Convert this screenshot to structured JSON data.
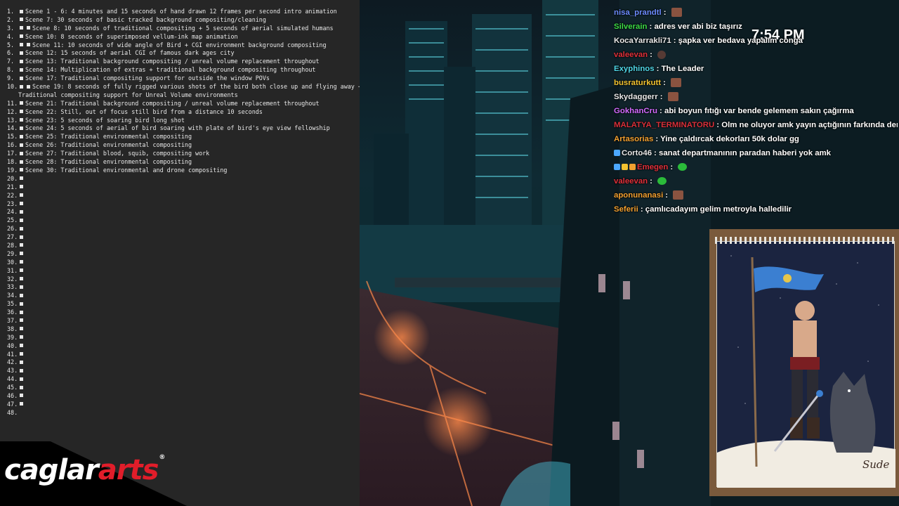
{
  "notes": {
    "items": [
      {
        "num": "1.",
        "text": "Scene 1 - 6: 4 minutes and 15 seconds of hand drawn 12 frames per second intro animation",
        "bullets": 1
      },
      {
        "num": "2.",
        "text": "Scene 7: 30 seconds of basic tracked background compositing/cleaning",
        "bullets": 1
      },
      {
        "num": "3.",
        "text": "Scene 8: 10 seconds of traditional compositing + 5 seconds of aerial simulated humans",
        "bullets": 2
      },
      {
        "num": "4.",
        "text": "Scene 10: 8 seconds of superimposed vellum-ink map animation",
        "bullets": 1
      },
      {
        "num": "5.",
        "text": "Scene 11: 10 seconds of wide angle of Bird + CGI environment background compositing",
        "bullets": 2
      },
      {
        "num": "6.",
        "text": "Scene 12: 15 seconds of aerial CGI of famous dark ages city",
        "bullets": 1
      },
      {
        "num": "7.",
        "text": "Scene 13: Traditional background compositing / unreal volume replacement throughout",
        "bullets": 1
      },
      {
        "num": "8.",
        "text": "Scene 14: Multiplication of extras + traditional background compositing throughout",
        "bullets": 1
      },
      {
        "num": "9.",
        "text": "Scene 17: Traditional compositing support for outside the window POVs",
        "bullets": 1
      },
      {
        "num": "10.",
        "text": "Scene 19: 8 seconds of fully rigged various shots of the bird both close up and flying away +",
        "bullets": 2,
        "wrap": "Traditional compositing support for Unreal Volume environments"
      },
      {
        "num": "11.",
        "text": "Scene 21: Traditional background compositing / unreal volume replacement throughout",
        "bullets": 1
      },
      {
        "num": "12.",
        "text": "Scene 22: Still, out of focus still bird from a distance 10 seconds",
        "bullets": 1
      },
      {
        "num": "13.",
        "text": "Scene 23: 5 seconds of soaring bird long shot",
        "bullets": 1
      },
      {
        "num": "14.",
        "text": "Scene 24: 5 seconds of aerial of bird soaring with plate of bird's eye view fellowship",
        "bullets": 1
      },
      {
        "num": "15.",
        "text": "Scene 25: Traditional environmental compositing",
        "bullets": 1
      },
      {
        "num": "16.",
        "text": "Scene 26: Traditional environmental compositing",
        "bullets": 1
      },
      {
        "num": "17.",
        "text": "Scene 27: Traditional blood, squib, compositing work",
        "bullets": 1
      },
      {
        "num": "18.",
        "text": "Scene 28: Traditional environmental compositing",
        "bullets": 1
      },
      {
        "num": "19.",
        "text": "Scene 30:  Traditional environmental and drone compositing",
        "bullets": 1
      },
      {
        "num": "20.",
        "text": "",
        "bullets": 1
      },
      {
        "num": "21.",
        "text": "",
        "bullets": 1
      },
      {
        "num": "22.",
        "text": "",
        "bullets": 1
      },
      {
        "num": "23.",
        "text": "",
        "bullets": 1
      },
      {
        "num": "24.",
        "text": "",
        "bullets": 1
      },
      {
        "num": "25.",
        "text": "",
        "bullets": 1
      },
      {
        "num": "26.",
        "text": "",
        "bullets": 1
      },
      {
        "num": "27.",
        "text": "",
        "bullets": 1
      },
      {
        "num": "28.",
        "text": "",
        "bullets": 1
      },
      {
        "num": "29.",
        "text": "",
        "bullets": 1
      },
      {
        "num": "30.",
        "text": "",
        "bullets": 1
      },
      {
        "num": "31.",
        "text": "",
        "bullets": 1
      },
      {
        "num": "32.",
        "text": "",
        "bullets": 1
      },
      {
        "num": "33.",
        "text": "",
        "bullets": 1
      },
      {
        "num": "34.",
        "text": "",
        "bullets": 1
      },
      {
        "num": "35.",
        "text": "",
        "bullets": 1
      },
      {
        "num": "36.",
        "text": "",
        "bullets": 1
      },
      {
        "num": "37.",
        "text": "",
        "bullets": 1
      },
      {
        "num": "38.",
        "text": "",
        "bullets": 1
      },
      {
        "num": "39.",
        "text": "",
        "bullets": 1
      },
      {
        "num": "40.",
        "text": "",
        "bullets": 1
      },
      {
        "num": "41.",
        "text": "",
        "bullets": 1
      },
      {
        "num": "42.",
        "text": "",
        "bullets": 1
      },
      {
        "num": "43.",
        "text": "",
        "bullets": 1
      },
      {
        "num": "44.",
        "text": "",
        "bullets": 1
      },
      {
        "num": "45.",
        "text": "",
        "bullets": 1
      },
      {
        "num": "46.",
        "text": "",
        "bullets": 1
      },
      {
        "num": "47.",
        "text": "",
        "bullets": 1
      },
      {
        "num": "48.",
        "text": "",
        "bullets": 0
      }
    ]
  },
  "logo": {
    "part1": "caglar",
    "part2": "arts",
    "reg": "®"
  },
  "clock": "7:54 PM",
  "chat": [
    {
      "user": "nisa_prandtl",
      "color": "#6c8cff",
      "sep": ":",
      "msg": "",
      "emote": "bear"
    },
    {
      "user": "Silverain",
      "color": "#3ddc46",
      "sep": ":",
      "msg": "adres ver abi biz taşırız"
    },
    {
      "user": "KocaYarrakli71",
      "color": "#e8e8e8",
      "sep": ":",
      "msg": "şapka ver bedava yapalım conga"
    },
    {
      "user": "valeevan",
      "color": "#e0303a",
      "sep": ":",
      "msg": "",
      "emote": "face"
    },
    {
      "user": "Exyphinos",
      "color": "#4fd6e6",
      "sep": ":",
      "msg": "The Leader"
    },
    {
      "user": "busraturkutt",
      "color": "#f2c230",
      "sep": ":",
      "msg": "",
      "emote": "bear"
    },
    {
      "user": "Skydaggerr",
      "color": "#e8e8e8",
      "sep": ":",
      "msg": "",
      "emote": "bear"
    },
    {
      "user": "GokhanCru",
      "color": "#d36bff",
      "sep": ":",
      "msg": "abi boyun fıtığı var bende gelemem sakın çağırma"
    },
    {
      "user": "MALATYA_TERMINATORU",
      "color": "#d9303a",
      "sep": ":",
      "msg": "Olm ne oluyor amk yayın açtığının farkında demi"
    },
    {
      "user": "Artasorias",
      "color": "#f2a030",
      "sep": ":",
      "msg": "Yine çaldırcak dekorları 50k dolar gg"
    },
    {
      "user": "Corto46",
      "color": "#e8e8e8",
      "sep": ":",
      "msg": "sanat departmanının paradan haberi yok amk",
      "badges": [
        "#4ca8ff"
      ]
    },
    {
      "user": "Emegen",
      "color": "#e0303a",
      "sep": ":",
      "msg": "",
      "emote": "green",
      "badges": [
        "#4ca8ff",
        "#f2c230",
        "#f2a030"
      ]
    },
    {
      "user": "valeevan",
      "color": "#e0303a",
      "sep": ":",
      "msg": "",
      "emote": "green"
    },
    {
      "user": "aponunanasi",
      "color": "#f2a030",
      "sep": ":",
      "msg": "",
      "emote": "bear"
    },
    {
      "user": "Seferii",
      "color": "#f2a030",
      "sep": ":",
      "msg": "çamlıcadayım gelim metroyla halledilir"
    }
  ],
  "drawing": {
    "signature": "Sude"
  },
  "colors": {
    "panel": "#262626",
    "accent_red": "#e11d2a",
    "card_bg": "#1b2440",
    "frame": "#7a5a3c"
  }
}
